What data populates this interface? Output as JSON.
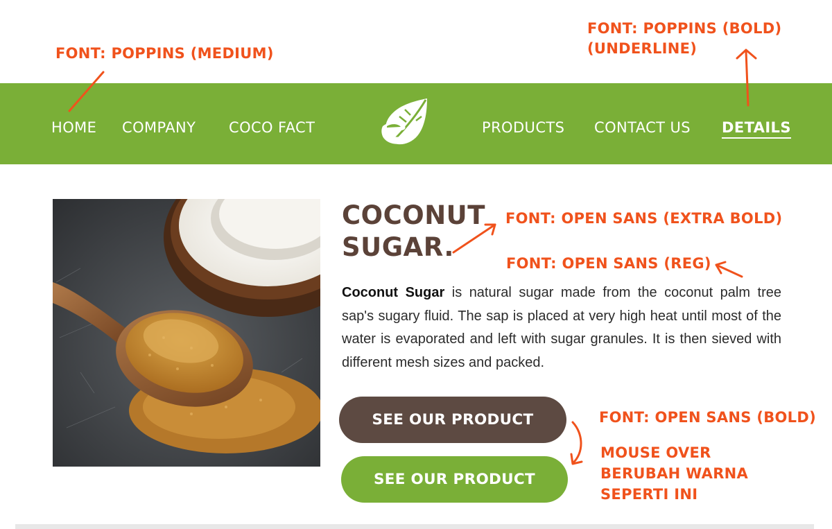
{
  "annotations": {
    "poppins_medium": "FONT: POPPINS (MEDIUM)",
    "poppins_bold_line1": "FONT: POPPINS (BOLD)",
    "poppins_bold_line2": "(UNDERLINE)",
    "open_sans_extra_bold": "FONT: OPEN SANS (EXTRA BOLD)",
    "open_sans_reg": "FONT: OPEN SANS (REG)",
    "open_sans_bold": "FONT: OPEN SANS (BOLD)",
    "mouse_over": [
      "MOUSE OVER",
      "BERUBAH WARNA",
      "SEPERTI INI"
    ]
  },
  "nav": {
    "home": "HOME",
    "company": "COMPANY",
    "coco_fact": "COCO FACT",
    "products": "PRODUCTS",
    "contact": "CONTACT US",
    "details": "DETAILS",
    "logo_icon": "leaf-e-logo-icon"
  },
  "content": {
    "title_line1": "COCONUT",
    "title_line2": "SUGAR.",
    "desc_bold": "Coconut Sugar",
    "desc_rest": " is natural sugar made from the coconut palm tree sap's sugary fluid. The sap is placed at very high heat until most of the water is evaporated and left with sugar granules. It is then sieved with different mesh sizes and packed.",
    "button_default": "SEE OUR PRODUCT",
    "button_hover": "SEE OUR PRODUCT"
  },
  "colors": {
    "nav_green": "#7aaf37",
    "title_brown": "#5b4238",
    "button_brown": "#5d4a42",
    "button_hover_green": "#7aaf37",
    "annotation_orange": "#f0521c"
  }
}
